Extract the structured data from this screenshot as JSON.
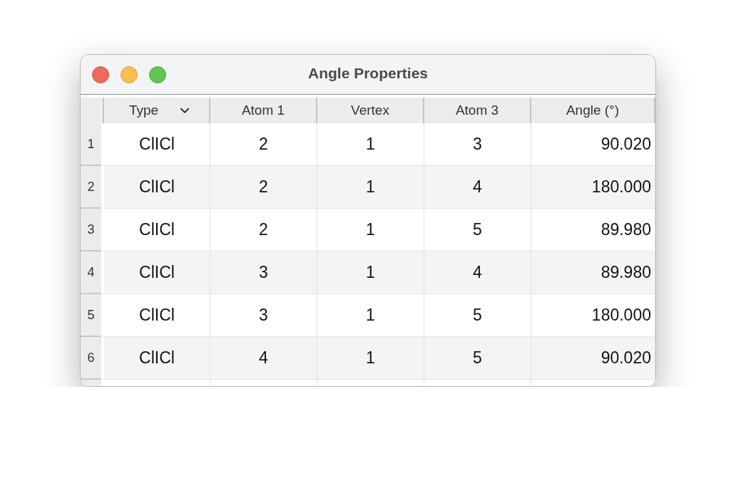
{
  "window": {
    "title": "Angle Properties"
  },
  "table": {
    "columns": [
      {
        "label": "Type",
        "kind": "dropdown"
      },
      {
        "label": "Atom 1",
        "kind": "plain"
      },
      {
        "label": "Vertex",
        "kind": "plain"
      },
      {
        "label": "Atom 3",
        "kind": "plain"
      },
      {
        "label": "Angle (°)",
        "kind": "plain"
      }
    ],
    "rows": [
      {
        "number": "1",
        "cells": [
          "ClICl",
          "2",
          "1",
          "3",
          "90.020"
        ]
      },
      {
        "number": "2",
        "cells": [
          "ClICl",
          "2",
          "1",
          "4",
          "180.000"
        ]
      },
      {
        "number": "3",
        "cells": [
          "ClICl",
          "2",
          "1",
          "5",
          "89.980"
        ]
      },
      {
        "number": "4",
        "cells": [
          "ClICl",
          "3",
          "1",
          "4",
          "89.980"
        ]
      },
      {
        "number": "5",
        "cells": [
          "ClICl",
          "3",
          "1",
          "5",
          "180.000"
        ]
      },
      {
        "number": "6",
        "cells": [
          "ClICl",
          "4",
          "1",
          "5",
          "90.020"
        ]
      }
    ]
  }
}
